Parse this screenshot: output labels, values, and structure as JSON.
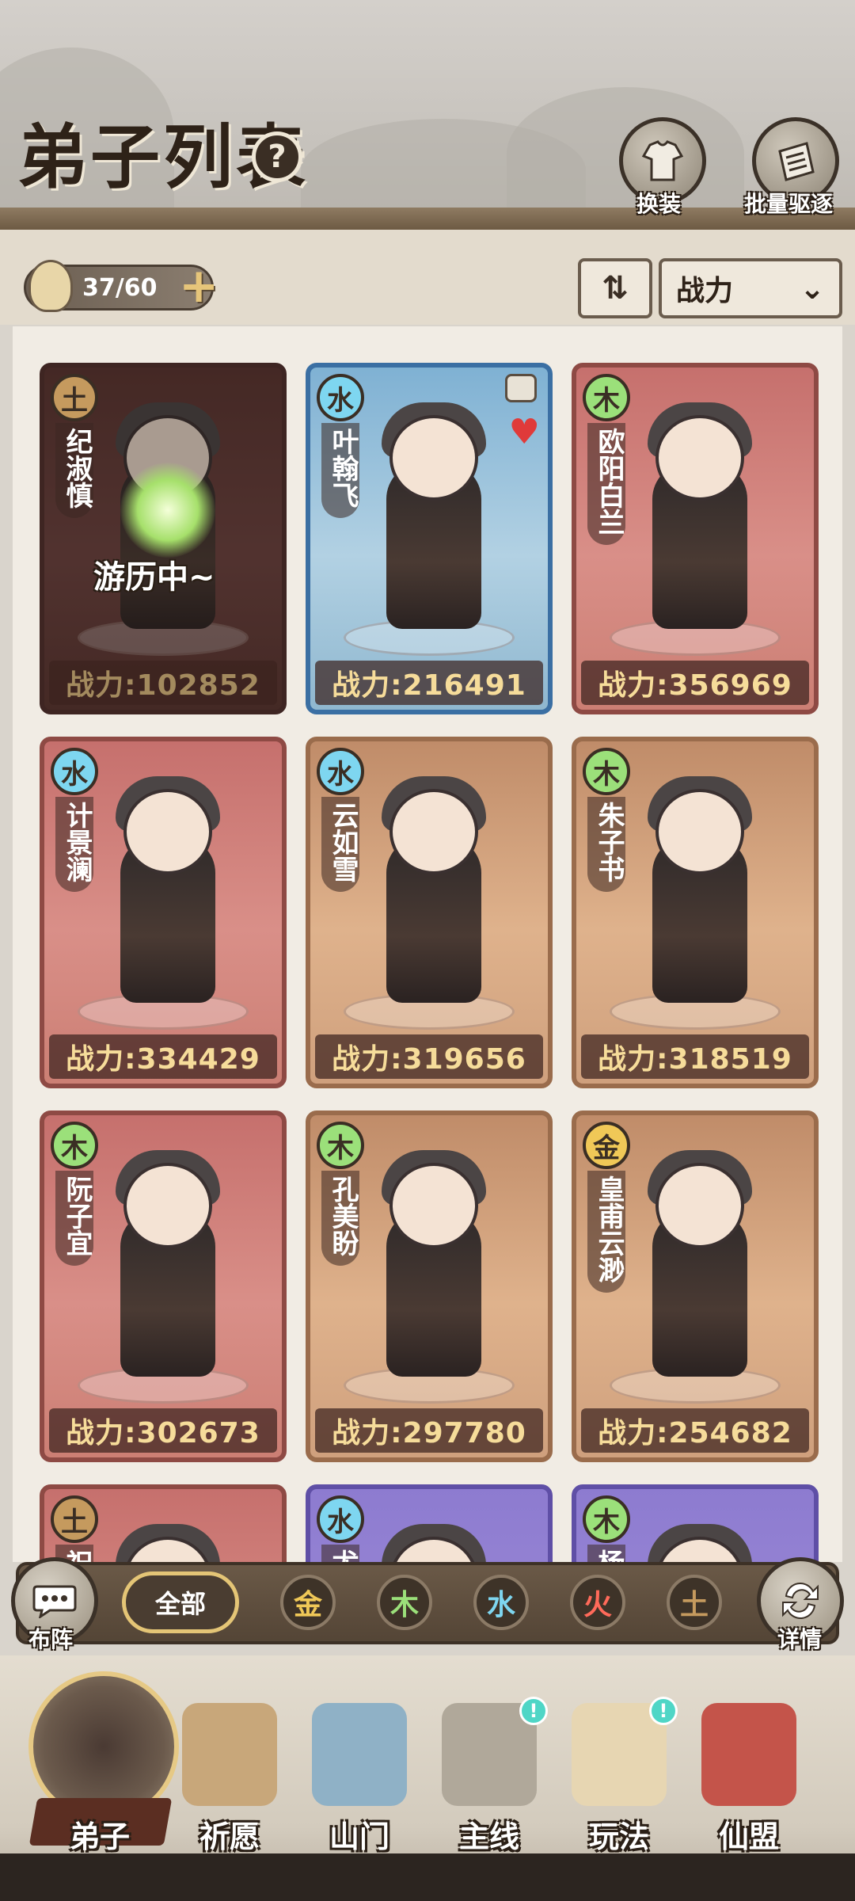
{
  "header": {
    "title": "弟子列表",
    "help_icon": "?",
    "buttons": [
      {
        "label": "换装",
        "icon": "outfit-icon"
      },
      {
        "label": "批量驱逐",
        "icon": "dismiss-icon"
      }
    ]
  },
  "toolbar": {
    "disciple_count": "37/60",
    "add_icon": "plus-icon",
    "sort_icon": "⇅",
    "sort_value": "战力",
    "sort_chevron": "⌄"
  },
  "disciples": [
    {
      "element": "土",
      "name": "纪淑慎",
      "power": "战力:102852",
      "status": "游历中~",
      "color": "dark"
    },
    {
      "element": "水",
      "name": "叶翰飞",
      "power": "战力:216491",
      "color": "blue",
      "favorite": true,
      "locked": true
    },
    {
      "element": "木",
      "name": "欧阳白兰",
      "power": "战力:356969",
      "color": "red"
    },
    {
      "element": "水",
      "name": "计景澜",
      "power": "战力:334429",
      "color": "red"
    },
    {
      "element": "水",
      "name": "云如雪",
      "power": "战力:319656",
      "color": "tan"
    },
    {
      "element": "木",
      "name": "朱子书",
      "power": "战力:318519",
      "color": "tan"
    },
    {
      "element": "木",
      "name": "阮子宜",
      "power": "战力:302673",
      "color": "red"
    },
    {
      "element": "木",
      "name": "孔美盼",
      "power": "战力:297780",
      "color": "tan"
    },
    {
      "element": "金",
      "name": "皇甫云渺",
      "power": "战力:254682",
      "color": "tan"
    },
    {
      "element": "土",
      "name": "祝",
      "color": "red"
    },
    {
      "element": "水",
      "name": "尤",
      "color": "purple"
    },
    {
      "element": "木",
      "name": "杨",
      "color": "purple"
    }
  ],
  "filters": {
    "left_button": "布阵",
    "all": "全部",
    "elements": [
      {
        "label": "金",
        "color": "#f0c857"
      },
      {
        "label": "木",
        "color": "#9be07a"
      },
      {
        "label": "水",
        "color": "#7ed6f0"
      },
      {
        "label": "火",
        "color": "#ff6a5a"
      },
      {
        "label": "土",
        "color": "#c59a5e"
      }
    ],
    "right_button": "详情"
  },
  "nav": [
    {
      "label": "弟子",
      "active": true
    },
    {
      "label": "祈愿"
    },
    {
      "label": "山门"
    },
    {
      "label": "主线",
      "alert": "!"
    },
    {
      "label": "玩法",
      "alert": "!"
    },
    {
      "label": "仙盟"
    }
  ],
  "colors": {
    "power_text": "#f6dc9a",
    "accent_gold": "#e4c576",
    "alert": "#4fd6c6"
  }
}
